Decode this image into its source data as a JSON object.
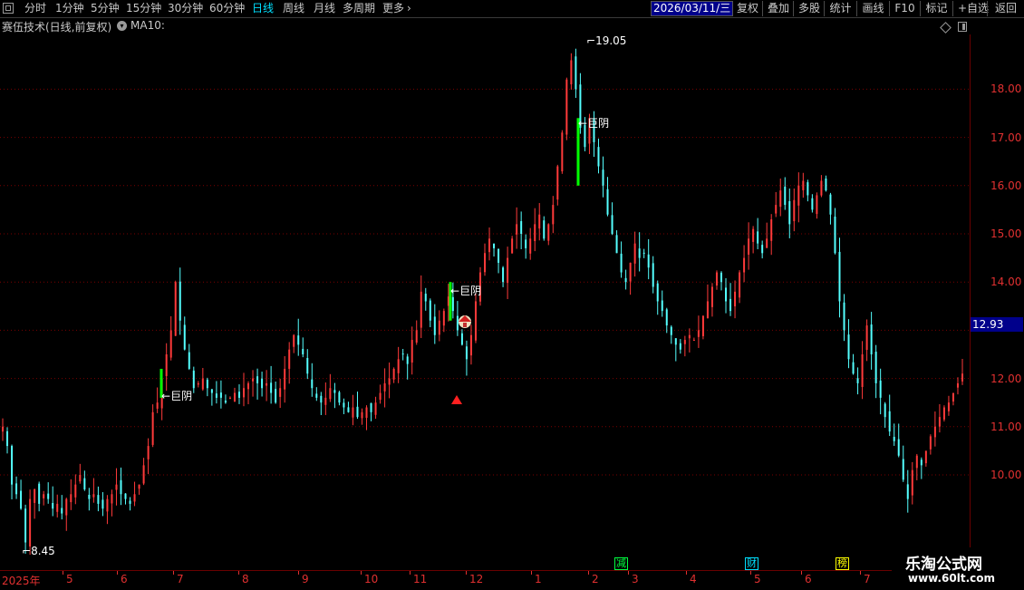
{
  "toolbar": {
    "left": [
      {
        "label": "分时",
        "active": false
      },
      {
        "label": "1分钟",
        "active": false
      },
      {
        "label": "5分钟",
        "active": false
      },
      {
        "label": "15分钟",
        "active": false
      },
      {
        "label": "30分钟",
        "active": false
      },
      {
        "label": "60分钟",
        "active": false
      },
      {
        "label": "日线",
        "active": true
      },
      {
        "label": "周线",
        "active": false
      },
      {
        "label": "月线",
        "active": false
      },
      {
        "label": "多周期",
        "active": false
      },
      {
        "label": "更多",
        "active": false
      }
    ],
    "more_arrow": "›",
    "right": [
      "复权",
      "叠加",
      "多股",
      "统计",
      "画线",
      "F10",
      "标记",
      "+自选",
      "返回"
    ]
  },
  "header": {
    "title": "赛伍技术(日线,前复权)",
    "dropdown_glyph": "▾",
    "indicator": "MA10:"
  },
  "price_axis": {
    "ticks": [
      "18.00",
      "17.00",
      "16.00",
      "15.00",
      "14.00",
      "12.00",
      "11.00",
      "10.00"
    ],
    "current_price": "12.93"
  },
  "annotations": {
    "high": "19.05",
    "low": "8.45",
    "signal_label": "巨阴"
  },
  "date_axis": {
    "labels": [
      "2025年",
      "5",
      "6",
      "7",
      "8",
      "9",
      "10",
      "11",
      "12",
      "1",
      "2",
      "3",
      "4",
      "5",
      "6",
      "7"
    ],
    "cursor_date": "2026/03/11/三"
  },
  "event_markers": [
    {
      "label": "减",
      "color": "#00ff40"
    },
    {
      "label": "财",
      "color": "#00e0ff"
    },
    {
      "label": "榜",
      "color": "#ffff00"
    }
  ],
  "watermark": {
    "brand": "乐淘公式网",
    "url": "www.60lt.com"
  },
  "colors": {
    "up": "#ff3a3a",
    "down": "#54ffff",
    "signal_bar": "#00ff00",
    "grid": "#7a0000",
    "price_axis_text": "#e03030",
    "badge": "#00008b"
  },
  "chart_data": {
    "type": "candlestick",
    "title": "赛伍技术(日线,前复权)",
    "y_unit": "price",
    "ylim": [
      8.0,
      19.5
    ],
    "grid": "horizontal dotted",
    "period_markers": [
      "2025年",
      "5",
      "6",
      "7",
      "8",
      "9",
      "10",
      "11",
      "12",
      "1",
      "2",
      "3",
      "4",
      "5",
      "6",
      "7"
    ],
    "series": [
      {
        "name": "price",
        "close_path": [
          11.0,
          10.6,
          9.8,
          9.6,
          9.3,
          8.6,
          9.5,
          9.7,
          9.4,
          9.6,
          9.5,
          9.3,
          9.4,
          9.2,
          9.5,
          9.6,
          9.8,
          10.0,
          9.7,
          9.5,
          9.6,
          9.4,
          9.3,
          9.5,
          9.6,
          9.8,
          9.6,
          9.5,
          9.4,
          9.6,
          9.8,
          10.2,
          10.6,
          11.3,
          11.5,
          12.0,
          12.5,
          13.0,
          14.0,
          13.2,
          12.6,
          12.2,
          11.8,
          11.9,
          12.0,
          11.8,
          11.7,
          11.6,
          11.6,
          11.5,
          11.6,
          11.7,
          11.6,
          11.8,
          11.9,
          12.0,
          11.9,
          11.8,
          11.9,
          11.7,
          11.5,
          11.8,
          12.2,
          12.6,
          12.9,
          12.7,
          12.5,
          12.1,
          11.8,
          11.6,
          11.5,
          11.6,
          11.8,
          11.7,
          11.5,
          11.4,
          11.3,
          11.4,
          11.2,
          11.3,
          11.4,
          11.3,
          11.5,
          11.7,
          11.9,
          12.0,
          12.2,
          12.4,
          12.5,
          12.3,
          12.8,
          13.0,
          13.8,
          13.6,
          13.2,
          12.9,
          13.2,
          13.4,
          13.7,
          13.4,
          13.0,
          12.7,
          12.4,
          12.9,
          13.6,
          14.2,
          14.6,
          14.9,
          14.7,
          14.4,
          14.0,
          14.5,
          14.9,
          15.2,
          15.0,
          14.7,
          14.9,
          15.2,
          15.4,
          14.9,
          15.2,
          15.6,
          16.4,
          17.1,
          18.2,
          18.6,
          18.0,
          17.2,
          16.8,
          17.4,
          16.9,
          16.4,
          16.0,
          15.4,
          15.0,
          14.6,
          14.2,
          14.0,
          14.4,
          14.8,
          14.5,
          14.6,
          14.3,
          13.9,
          13.6,
          13.4,
          13.1,
          12.9,
          12.7,
          12.6,
          12.8,
          12.9,
          12.8,
          13.0,
          13.3,
          13.6,
          13.9,
          14.2,
          14.0,
          13.6,
          13.4,
          13.8,
          14.2,
          14.5,
          14.9,
          15.1,
          14.8,
          14.6,
          14.9,
          15.3,
          15.6,
          15.9,
          15.6,
          15.2,
          15.7,
          16.0,
          16.1,
          15.8,
          15.5,
          15.8,
          16.1,
          15.9,
          15.4,
          14.6,
          13.6,
          13.0,
          12.4,
          12.1,
          11.9,
          12.5,
          13.1,
          12.5,
          11.9,
          11.6,
          11.2,
          10.9,
          10.7,
          10.4,
          9.9,
          9.5,
          10.1,
          10.4,
          10.2,
          10.5,
          10.8,
          11.0,
          11.2,
          11.4,
          11.5,
          11.7,
          11.9,
          12.1
        ]
      }
    ],
    "signals": [
      {
        "label": "巨阴",
        "near_price": 11.6
      },
      {
        "label": "巨阴",
        "near_price": 13.8
      },
      {
        "label": "巨阴",
        "near_price": 17.3
      }
    ],
    "high_label": 19.05,
    "low_label": 8.45
  }
}
